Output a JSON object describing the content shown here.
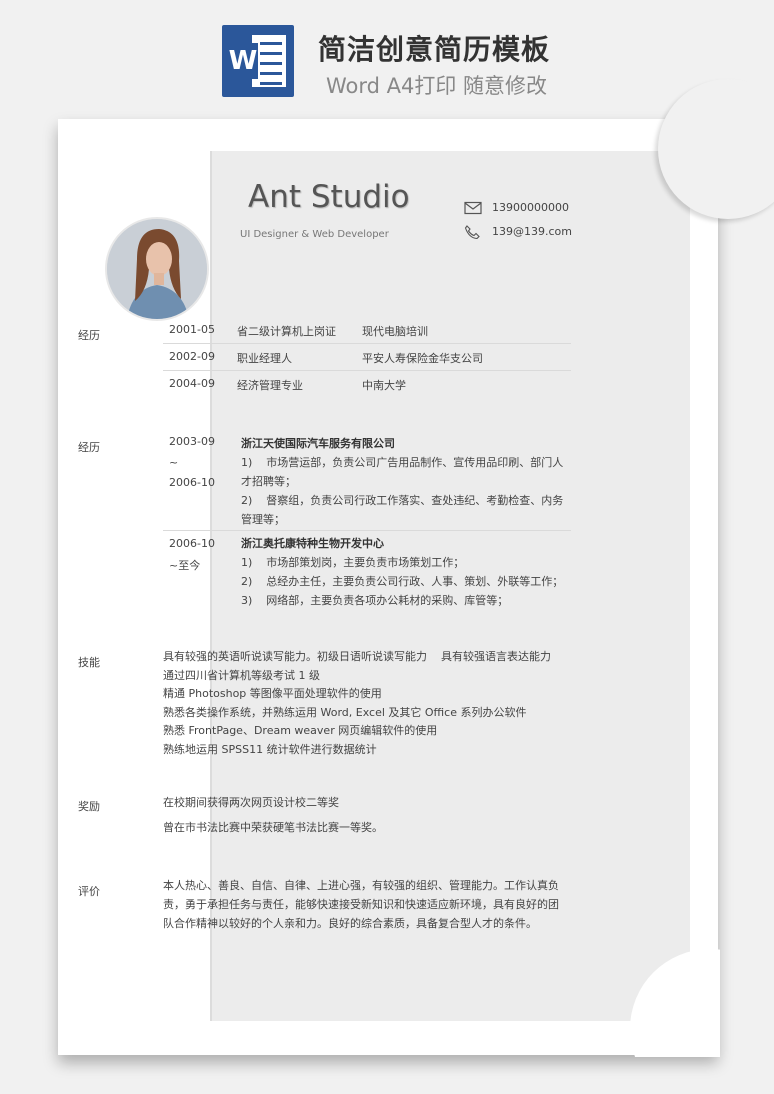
{
  "banner": {
    "title": "简洁创意简历模板",
    "subtitle": "Word A4打印 随意修改",
    "icon_letter": "W"
  },
  "header": {
    "name": "Ant Studio",
    "role": "UI Designer & Web Developer",
    "phone": "13900000000",
    "email": "139@139.com"
  },
  "education": {
    "label": "经历",
    "rows": [
      {
        "date": "2001-05",
        "title": "省二级计算机上岗证",
        "org": "现代电脑培训"
      },
      {
        "date": "2002-09",
        "title": "职业经理人",
        "org": "平安人寿保险金华支公司"
      },
      {
        "date": "2004-09",
        "title": "经济管理专业",
        "org": "中南大学"
      }
    ]
  },
  "experience": {
    "label": "经历",
    "jobs": [
      {
        "start": "2003-09",
        "sep": "~",
        "end": "2006-10",
        "company": "浙江天使国际汽车服务有限公司",
        "lines": [
          "1)    市场营运部，负责公司广告用品制作、宣传用品印刷、部门人",
          "才招聘等；",
          "2)    督察组，负责公司行政工作落实、查处违纪、考勤检查、内务",
          "管理等；"
        ]
      },
      {
        "start": "2006-10",
        "sep": "",
        "end": "~至今",
        "company": "浙江奥托康特种生物开发中心",
        "lines": [
          "1)    市场部策划岗，主要负责市场策划工作；",
          "2)    总经办主任，主要负责公司行政、人事、策划、外联等工作；",
          "3)    网络部，主要负责各项办公耗材的采购、库管等；"
        ]
      }
    ]
  },
  "skills": {
    "label": "技能",
    "lines": [
      "具有较强的英语听说读写能力。初级日语听说读写能力    具有较强语言表达能力",
      "通过四川省计算机等级考试 1 级",
      "精通 Photoshop 等图像平面处理软件的使用",
      "熟悉各类操作系统，并熟练运用 Word, Excel 及其它 Office 系列办公软件",
      "熟悉 FrontPage、Dream weaver 网页编辑软件的使用",
      "熟练地运用 SPSS11 统计软件进行数据统计"
    ]
  },
  "awards": {
    "label": "奖励",
    "lines": [
      "在校期间获得两次网页设计校二等奖",
      "曾在市书法比赛中荣获硬笔书法比赛一等奖。"
    ]
  },
  "evaluation": {
    "label": "评价",
    "lines": [
      "本人热心、善良、自信、自律、上进心强，有较强的组织、管理能力。工作认真负",
      "责，勇于承担任务与责任，能够快速接受新知识和快速适应新环境，具有良好的团",
      "队合作精神以较好的个人亲和力。良好的综合素质，具备复合型人才的条件。"
    ]
  },
  "colors": {
    "word_blue": "#2b579a",
    "panel": "#ececec"
  }
}
